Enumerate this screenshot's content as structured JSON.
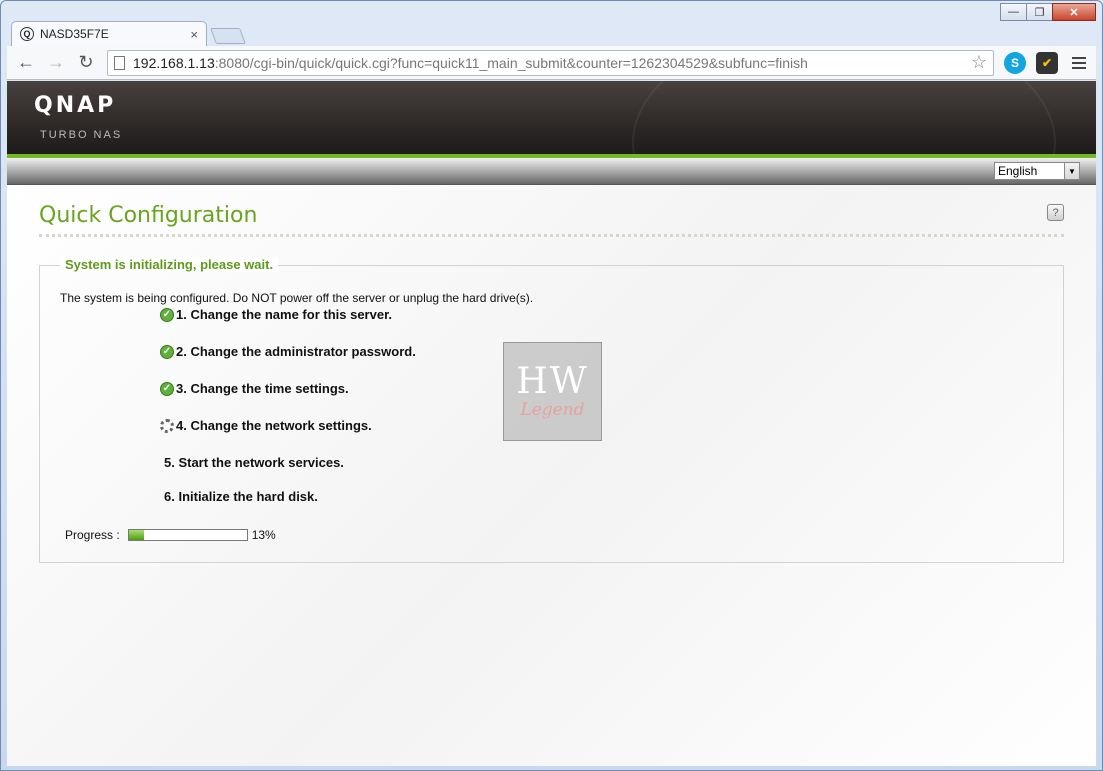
{
  "window": {
    "minimize_label": "—",
    "maximize_label": "❐",
    "close_label": "✕"
  },
  "tab": {
    "title": "NASD35F7E",
    "favicon_letter": "Q",
    "close_label": "×"
  },
  "toolbar": {
    "back_label": "←",
    "forward_label": "→",
    "reload_label": "↻",
    "url_host": "192.168.1.13",
    "url_rest": ":8080/cgi-bin/quick/quick.cgi?func=quick11_main_submit&counter=1262304529&subfunc=finish",
    "star_label": "☆",
    "ext_skype_label": "S",
    "ext_check_label": "✔"
  },
  "header": {
    "logo": "QNAP",
    "subtitle": "TURBO NAS"
  },
  "language": {
    "selected": "English",
    "arrow": "▼"
  },
  "page": {
    "title": "Quick Configuration",
    "help_label": "?",
    "section_title": "System is initializing, please wait.",
    "notice": "The system is being configured. Do NOT power off the server or unplug the hard drive(s).",
    "steps": [
      {
        "label": "1. Change the name for this server.",
        "status": "done"
      },
      {
        "label": "2. Change the administrator password.",
        "status": "done"
      },
      {
        "label": "3. Change the time settings.",
        "status": "done"
      },
      {
        "label": "4. Change the network settings.",
        "status": "in-progress"
      },
      {
        "label": "5. Start the network services.",
        "status": "pending"
      },
      {
        "label": "6. Initialize the hard disk.",
        "status": "pending"
      }
    ],
    "check_glyph": "✓",
    "progress_label": "Progress :",
    "progress_percent": 13,
    "progress_text": "13%"
  },
  "watermark": {
    "top": "HW",
    "bottom": "Legend"
  },
  "colors": {
    "accent_green": "#76b82a",
    "title_green": "#6aa41f"
  }
}
